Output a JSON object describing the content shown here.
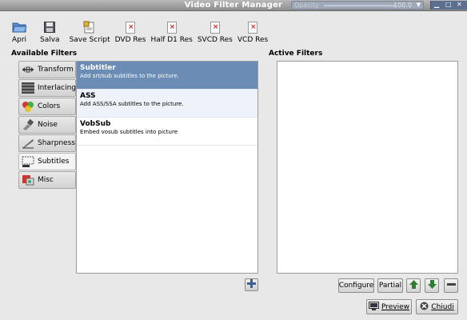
{
  "window": {
    "title": "Video Filter Manager",
    "opacity_label": "Opacity",
    "opacity_value": "100.0"
  },
  "toolbar": {
    "items": [
      {
        "label": "Apri"
      },
      {
        "label": "Salva"
      },
      {
        "label": "Save Script"
      },
      {
        "label": "DVD Res"
      },
      {
        "label": "Half D1 Res"
      },
      {
        "label": "SVCD Res"
      },
      {
        "label": "VCD Res"
      }
    ]
  },
  "available": {
    "heading": "Available Filters",
    "categories": [
      {
        "label": "Transform"
      },
      {
        "label": "Interlacing"
      },
      {
        "label": "Colors"
      },
      {
        "label": "Noise"
      },
      {
        "label": "Sharpness"
      },
      {
        "label": "Subtitles"
      },
      {
        "label": "Misc"
      }
    ],
    "active_category": "Subtitles",
    "filters": [
      {
        "name": "Subtitler",
        "desc": "Add srt/sub subtitles to the picture."
      },
      {
        "name": "ASS",
        "desc": "Add ASS/SSA subtitles to the picture."
      },
      {
        "name": "VobSub",
        "desc": "Embed vosub subtitles into picture"
      }
    ]
  },
  "active": {
    "heading": "Active Filters",
    "configure_label": "Configure",
    "partial_label": "Partial"
  },
  "footer": {
    "preview_label": "Preview",
    "close_label": "Chiudi"
  }
}
